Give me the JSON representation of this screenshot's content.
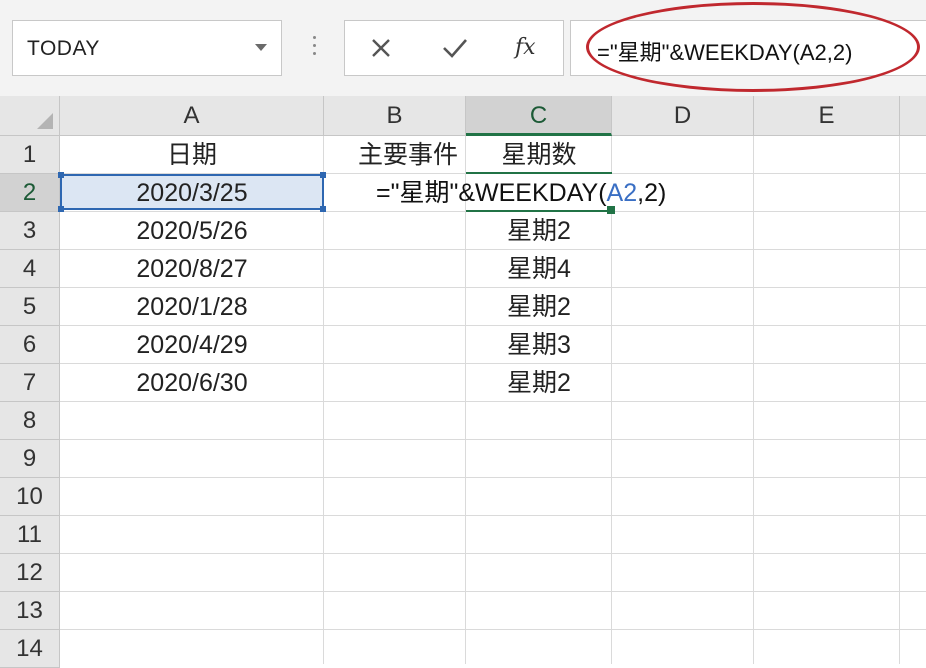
{
  "formula_bar": {
    "name_box": "TODAY",
    "formula": "=\"星期\"&WEEKDAY(A2,2)",
    "fx_label": "fx",
    "cancel_icon": "close-icon",
    "enter_icon": "checkmark-icon"
  },
  "columns": [
    "A",
    "B",
    "C",
    "D",
    "E"
  ],
  "rows": [
    "1",
    "2",
    "3",
    "4",
    "5",
    "6",
    "7",
    "8",
    "9",
    "10",
    "11",
    "12",
    "13",
    "14"
  ],
  "cells": {
    "A1": "日期",
    "B1": "主要事件",
    "C1": "星期数",
    "A2": "2020/3/25",
    "A3": "2020/5/26",
    "A4": "2020/8/27",
    "A5": "2020/1/28",
    "A6": "2020/4/29",
    "A7": "2020/6/30",
    "C3": "星期2",
    "C4": "星期4",
    "C5": "星期2",
    "C6": "星期3",
    "C7": "星期2"
  },
  "editing_cell": {
    "address": "C2",
    "parts": [
      "=\"星期\"&WEEKDAY(",
      "A2",
      ",2)"
    ]
  },
  "colors": {
    "selection_border": "#2e67b1",
    "reference_highlight": "#217346",
    "annotation_oval": "#c0282e",
    "reference_text": "#3a6fc4"
  }
}
